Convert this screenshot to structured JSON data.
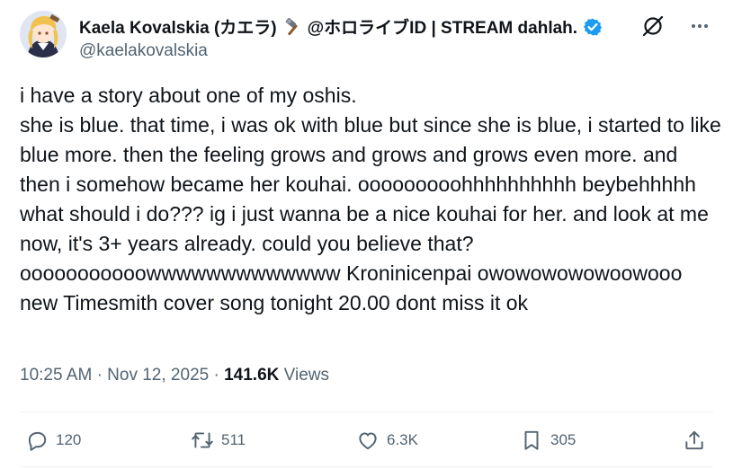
{
  "author": {
    "display_name": "Kaela Kovalskia (カエラ)",
    "name_suffix": "@ホロライブID | STREAM dahlah.",
    "handle": "@kaelakovalskia",
    "verified": true,
    "icons": [
      "hammer-emoji",
      "verified-badge-icon"
    ]
  },
  "header_actions": {
    "icons": [
      "grok-icon",
      "more-icon"
    ]
  },
  "tweet": {
    "text": "i have a story about one of my oshis.\nshe is blue. that time, i was ok with blue but since she is blue, i started to like blue more. then the feeling grows and grows and grows even more. and then i somehow became her kouhai. ooooooooohhhhhhhhhh beybehhhhh what should i do??? ig i just wanna be a nice kouhai for her. and look at me now, it's 3+ years already. could you believe that? ooooooooooowwwwwwwwwwwww Kroninicenpai owowowowowoowooo new Timesmith cover song tonight 20.00 dont miss it ok"
  },
  "meta": {
    "time": "10:25 AM",
    "separator": "·",
    "date": "Nov 12, 2025",
    "views_count": "141.6K",
    "views_label": "Views"
  },
  "actions": {
    "replies": "120",
    "reposts": "511",
    "likes": "6.3K",
    "bookmarks": "305"
  },
  "colors": {
    "text_primary": "#0f1419",
    "text_secondary": "#536471",
    "verified_blue": "#1d9bf0",
    "divider": "#eff3f4"
  }
}
